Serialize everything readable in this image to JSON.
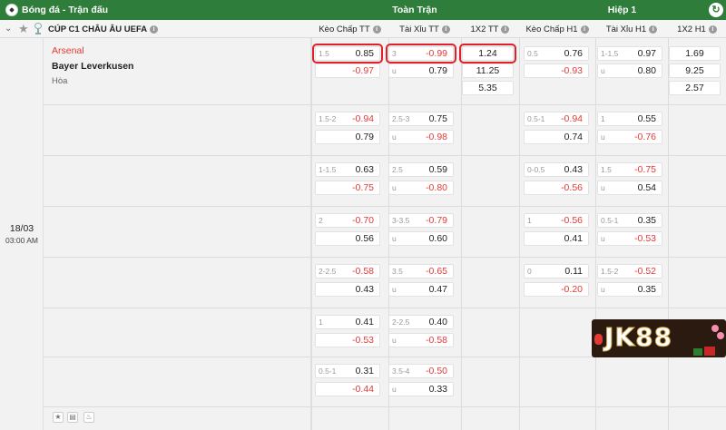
{
  "topbar": {
    "title": "Bóng đá - Trận đấu",
    "full_match": "Toàn Trận",
    "half1": "Hiệp 1",
    "refresh_icon": "refresh-icon"
  },
  "header": {
    "league": "CÚP C1 CHÂU ÂU UEFA",
    "cols": [
      "Kèo Chấp TT",
      "Tài Xỉu TT",
      "1X2 TT",
      "Kèo Chấp H1",
      "Tài Xỉu H1",
      "1X2 H1"
    ]
  },
  "match": {
    "date": "18/03",
    "time": "03:00 AM",
    "home": "Arsenal",
    "away": "Bayer Leverkusen",
    "draw": "Hòa"
  },
  "rows": [
    {
      "hdp_tt": [
        [
          "1.5",
          "0.85"
        ],
        [
          "",
          "-0.97"
        ]
      ],
      "ou_tt": [
        [
          "3",
          "-0.99"
        ],
        [
          "u",
          "0.79"
        ]
      ],
      "x12_tt": [
        "1.24",
        "11.25",
        "5.35"
      ],
      "hdp_h1": [
        [
          "0.5",
          "0.76"
        ],
        [
          "",
          "-0.93"
        ]
      ],
      "ou_h1": [
        [
          "1-1.5",
          "0.97"
        ],
        [
          "u",
          "0.80"
        ]
      ],
      "x12_h1": [
        "1.69",
        "9.25",
        "2.57"
      ]
    },
    {
      "hdp_tt": [
        [
          "1.5-2",
          "-0.94"
        ],
        [
          "",
          "0.79"
        ]
      ],
      "ou_tt": [
        [
          "2.5-3",
          "0.75"
        ],
        [
          "u",
          "-0.98"
        ]
      ],
      "hdp_h1": [
        [
          "0.5-1",
          "-0.94"
        ],
        [
          "",
          "0.74"
        ]
      ],
      "ou_h1": [
        [
          "1",
          "0.55"
        ],
        [
          "u",
          "-0.76"
        ]
      ]
    },
    {
      "hdp_tt": [
        [
          "1-1.5",
          "0.63"
        ],
        [
          "",
          "-0.75"
        ]
      ],
      "ou_tt": [
        [
          "2.5",
          "0.59"
        ],
        [
          "u",
          "-0.80"
        ]
      ],
      "hdp_h1": [
        [
          "0-0.5",
          "0.43"
        ],
        [
          "",
          "-0.56"
        ]
      ],
      "ou_h1": [
        [
          "1.5",
          "-0.75"
        ],
        [
          "u",
          "0.54"
        ]
      ]
    },
    {
      "hdp_tt": [
        [
          "2",
          "-0.70"
        ],
        [
          "",
          "0.56"
        ]
      ],
      "ou_tt": [
        [
          "3-3.5",
          "-0.79"
        ],
        [
          "u",
          "0.60"
        ]
      ],
      "hdp_h1": [
        [
          "1",
          "-0.56"
        ],
        [
          "",
          "0.41"
        ]
      ],
      "ou_h1": [
        [
          "0.5-1",
          "0.35"
        ],
        [
          "u",
          "-0.53"
        ]
      ]
    },
    {
      "hdp_tt": [
        [
          "2-2.5",
          "-0.58"
        ],
        [
          "",
          "0.43"
        ]
      ],
      "ou_tt": [
        [
          "3.5",
          "-0.65"
        ],
        [
          "u",
          "0.47"
        ]
      ],
      "hdp_h1": [
        [
          "0",
          "0.11"
        ],
        [
          "",
          "-0.20"
        ]
      ],
      "ou_h1": [
        [
          "1.5-2",
          "-0.52"
        ],
        [
          "u",
          "0.35"
        ]
      ]
    },
    {
      "hdp_tt": [
        [
          "1",
          "0.41"
        ],
        [
          "",
          "-0.53"
        ]
      ],
      "ou_tt": [
        [
          "2-2.5",
          "0.40"
        ],
        [
          "u",
          "-0.58"
        ]
      ]
    },
    {
      "hdp_tt": [
        [
          "0.5-1",
          "0.31"
        ],
        [
          "",
          "-0.44"
        ]
      ],
      "ou_tt": [
        [
          "3.5-4",
          "-0.50"
        ],
        [
          "u",
          "0.33"
        ]
      ]
    }
  ],
  "colors": {
    "topbar": "#2e7d3a",
    "negative": "#e53935",
    "highlight": "#e0202a",
    "background": "#f2f2f2"
  },
  "logo": {
    "text": "JK88"
  }
}
